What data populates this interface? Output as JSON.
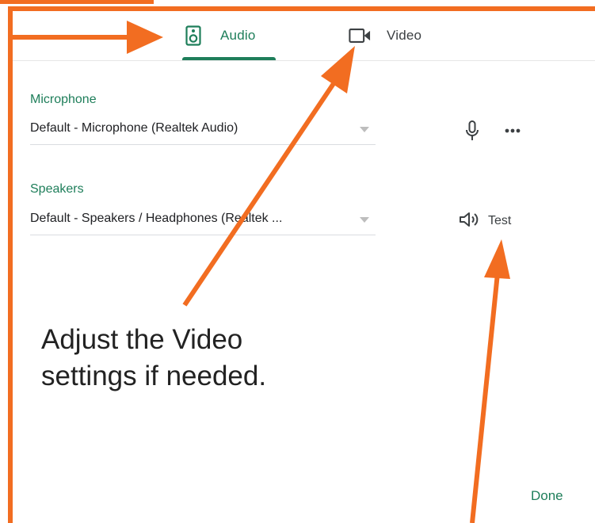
{
  "tabs": [
    {
      "label": "Audio",
      "icon": "speaker-icon",
      "selected": true
    },
    {
      "label": "Video",
      "icon": "video-camera-icon",
      "selected": false
    }
  ],
  "microphone": {
    "label": "Microphone",
    "selected": "Default - Microphone (Realtek Audio)",
    "icon": "microphone-icon",
    "more_icon": "more-horiz-icon"
  },
  "speakers": {
    "label": "Speakers",
    "selected": "Default - Speakers / Headphones (Realtek ...",
    "icon": "speaker-volume-icon",
    "test_label": "Test"
  },
  "annotation": "Adjust the Video\nsettings if needed.",
  "done_label": "Done",
  "colors": {
    "accent": "#1e7e5a",
    "annotation_orange": "#f26d21"
  }
}
